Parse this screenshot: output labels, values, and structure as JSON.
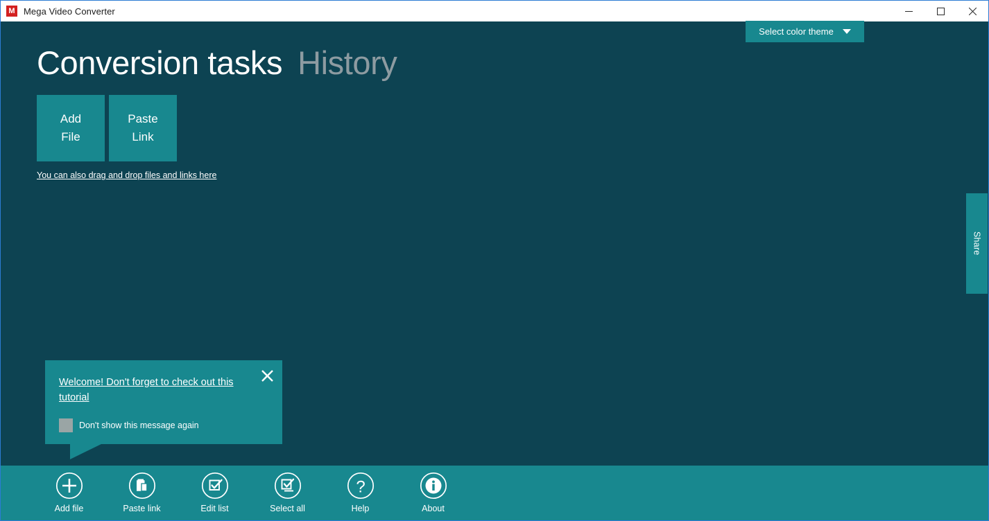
{
  "window": {
    "title": "Mega Video Converter",
    "app_icon_letter": "M",
    "app_icon_color": "#d32020",
    "controls": {
      "minimize": "minimize-button",
      "maximize": "maximize-button",
      "close": "close-button"
    }
  },
  "theme": {
    "label": "Select color theme"
  },
  "heading": {
    "active_tab": "Conversion tasks",
    "inactive_tab": "History"
  },
  "actions": {
    "add_file": {
      "line1": "Add",
      "line2": "File"
    },
    "paste_link": {
      "line1": "Paste",
      "line2": "Link"
    },
    "drag_hint": "You can also drag and drop files and links here"
  },
  "share": {
    "label": "Share"
  },
  "popup": {
    "message": "Welcome! Don't forget to check out this tutorial",
    "checkbox_label": "Don't show this message again",
    "checkbox_checked": false,
    "close_label": "✕"
  },
  "toolbar": {
    "items": [
      {
        "label": "Add file",
        "icon": "plus-icon"
      },
      {
        "label": "Paste link",
        "icon": "clipboard-icon"
      },
      {
        "label": "Edit list",
        "icon": "edit-list-icon"
      },
      {
        "label": "Select all",
        "icon": "select-all-icon"
      },
      {
        "label": "Help",
        "icon": "question-icon"
      },
      {
        "label": "About",
        "icon": "info-icon"
      }
    ]
  },
  "colors": {
    "background": "#0d4352",
    "accent": "#18888f",
    "titlebar": "#ffffff",
    "border": "#2b7cd3",
    "inactive_text": "#8d9ba1",
    "checkbox": "#9aa5a5"
  }
}
